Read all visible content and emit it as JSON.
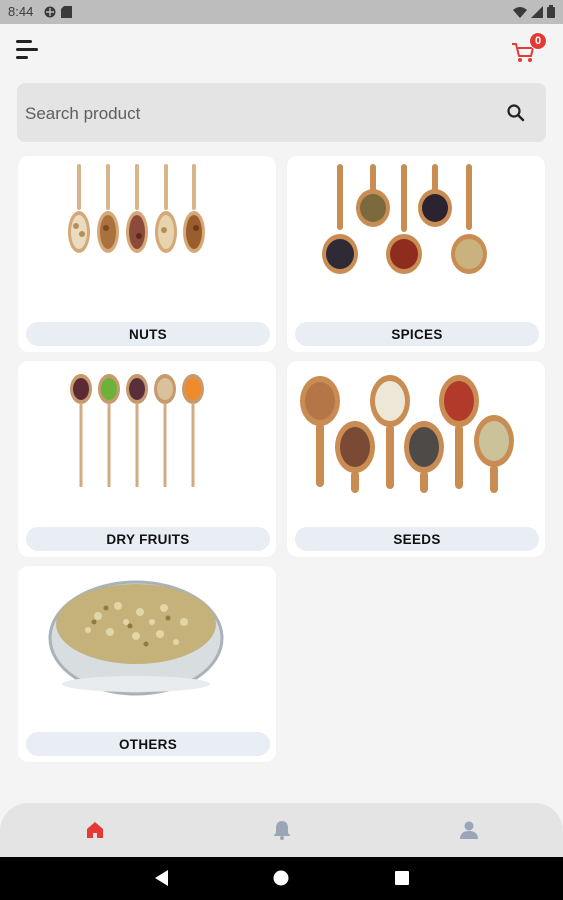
{
  "status_bar": {
    "time": "8:44"
  },
  "cart": {
    "count": "0"
  },
  "search": {
    "placeholder": "Search product",
    "value": ""
  },
  "categories": [
    {
      "label": "NUTS"
    },
    {
      "label": "SPICES"
    },
    {
      "label": "DRY FRUITS"
    },
    {
      "label": "SEEDS"
    },
    {
      "label": "OTHERS"
    }
  ],
  "bottom_nav": [
    {
      "icon": "home-icon",
      "active": true
    },
    {
      "icon": "bell-icon",
      "active": false
    },
    {
      "icon": "person-icon",
      "active": false
    }
  ],
  "colors": {
    "accent": "#e53935",
    "inactive_icon": "#9aa6b8",
    "label_bg": "#e9eef5"
  }
}
